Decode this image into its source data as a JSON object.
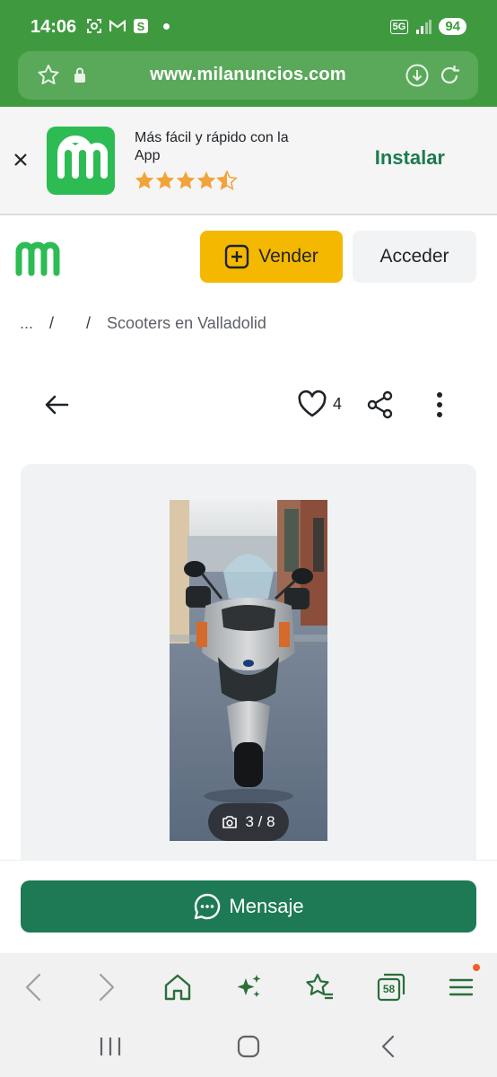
{
  "status_bar": {
    "time": "14:06",
    "network": "5G",
    "battery": "94"
  },
  "browser": {
    "url": "www.milanuncios.com",
    "icons": [
      "star-outline-icon",
      "lock-icon",
      "download-icon",
      "reload-icon"
    ]
  },
  "app_banner": {
    "title": "Más fácil y rápido con la App",
    "rating": 4.5,
    "install_label": "Instalar",
    "colors": {
      "install": "#1d7a50",
      "logo": "#2dbc54",
      "stars": "#f2a33a"
    }
  },
  "header": {
    "sell_label": "Vender",
    "login_label": "Acceder",
    "colors": {
      "sell_bg": "#f5b800",
      "login_bg": "#f2f3f5"
    }
  },
  "breadcrumb": {
    "items": [
      "...",
      "",
      "Scooters en Valladolid"
    ],
    "separator": "/"
  },
  "listing": {
    "favorites_count": "4",
    "photo_counter": "3 / 8",
    "current_photo": 3,
    "total_photos": 8
  },
  "actions": {
    "message_label": "Mensaje",
    "message_color": "#1d7a55"
  },
  "bottom_nav": {
    "tabs_count": "58",
    "icons": [
      "back-icon",
      "forward-icon",
      "home-icon",
      "sparkle-icon",
      "bookmarks-icon",
      "tabs-icon",
      "menu-icon"
    ]
  },
  "colors": {
    "chrome": "#3f9a3f",
    "urlbar": "#5aa95a"
  }
}
